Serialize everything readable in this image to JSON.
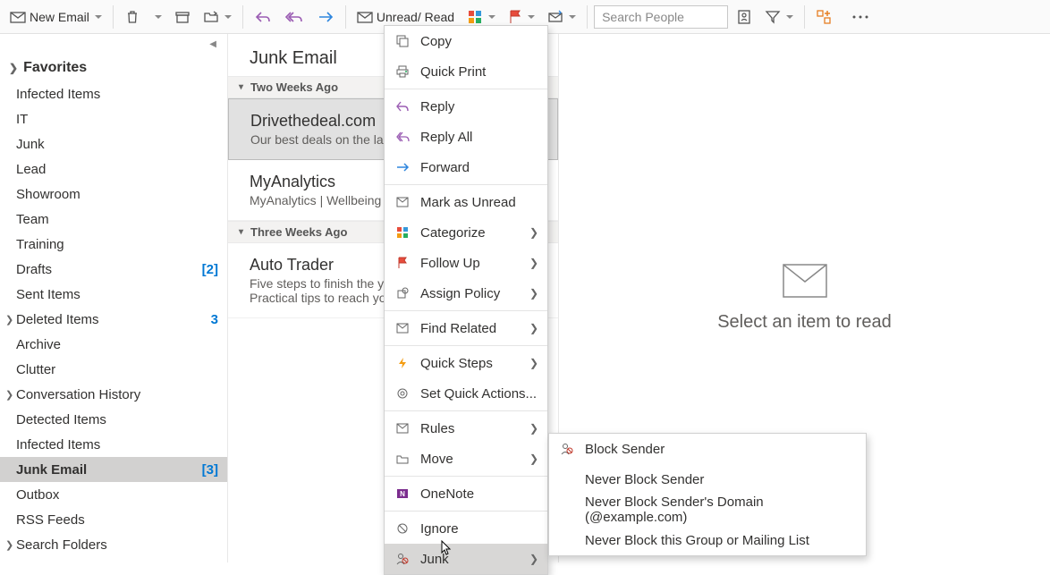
{
  "ribbon": {
    "new_email": "New Email",
    "unread_read": "Unread/ Read",
    "search_placeholder": "Search People"
  },
  "nav": {
    "favorites_header": "Favorites",
    "items": [
      {
        "label": "Infected Items",
        "indent": true
      },
      {
        "label": "IT",
        "indent": true
      },
      {
        "label": "Junk",
        "indent": true
      },
      {
        "label": "Lead",
        "indent": true
      },
      {
        "label": "Showroom",
        "indent": true
      },
      {
        "label": "Team",
        "indent": true
      },
      {
        "label": "Training",
        "indent": true
      },
      {
        "label": "Drafts",
        "badge": "[2]"
      },
      {
        "label": "Sent Items"
      },
      {
        "label": "Deleted Items",
        "expand": true,
        "badge": "3"
      },
      {
        "label": "Archive",
        "indent": true
      },
      {
        "label": "Clutter",
        "indent": true
      },
      {
        "label": "Conversation History",
        "expand": true
      },
      {
        "label": "Detected Items",
        "indent": true
      },
      {
        "label": "Infected Items",
        "indent": true
      },
      {
        "label": "Junk Email",
        "indent": true,
        "selected": true,
        "badge": "[3]"
      },
      {
        "label": "Outbox",
        "indent": true
      },
      {
        "label": "RSS Feeds",
        "indent": true
      },
      {
        "label": "Search Folders",
        "expand": true
      }
    ]
  },
  "list": {
    "title": "Junk Email",
    "groups": [
      {
        "header": "Two Weeks Ago",
        "messages": [
          {
            "from": "Drivethedeal.com",
            "subject": "Our best deals on the last",
            "selected": true
          },
          {
            "from": "MyAnalytics",
            "subject": "MyAnalytics | Wellbeing E"
          }
        ]
      },
      {
        "header": "Three Weeks Ago",
        "messages": [
          {
            "from": "Auto Trader",
            "subject": "Five steps to finish the ye",
            "preview": "Practical tips to reach you"
          }
        ]
      }
    ]
  },
  "reading": {
    "empty_text": "Select an item to read"
  },
  "context_menu": {
    "copy": "Copy",
    "quick_print": "Quick Print",
    "reply": "Reply",
    "reply_all": "Reply All",
    "forward": "Forward",
    "mark_unread": "Mark as Unread",
    "categorize": "Categorize",
    "follow_up": "Follow Up",
    "assign_policy": "Assign Policy",
    "find_related": "Find Related",
    "quick_steps": "Quick Steps",
    "set_quick_actions": "Set Quick Actions...",
    "rules": "Rules",
    "move": "Move",
    "onenote": "OneNote",
    "ignore": "Ignore",
    "junk": "Junk"
  },
  "submenu": {
    "block_sender": "Block Sender",
    "never_block_sender": "Never Block Sender",
    "never_block_domain": "Never Block Sender's Domain (@example.com)",
    "never_block_group": "Never Block this Group or Mailing List"
  }
}
